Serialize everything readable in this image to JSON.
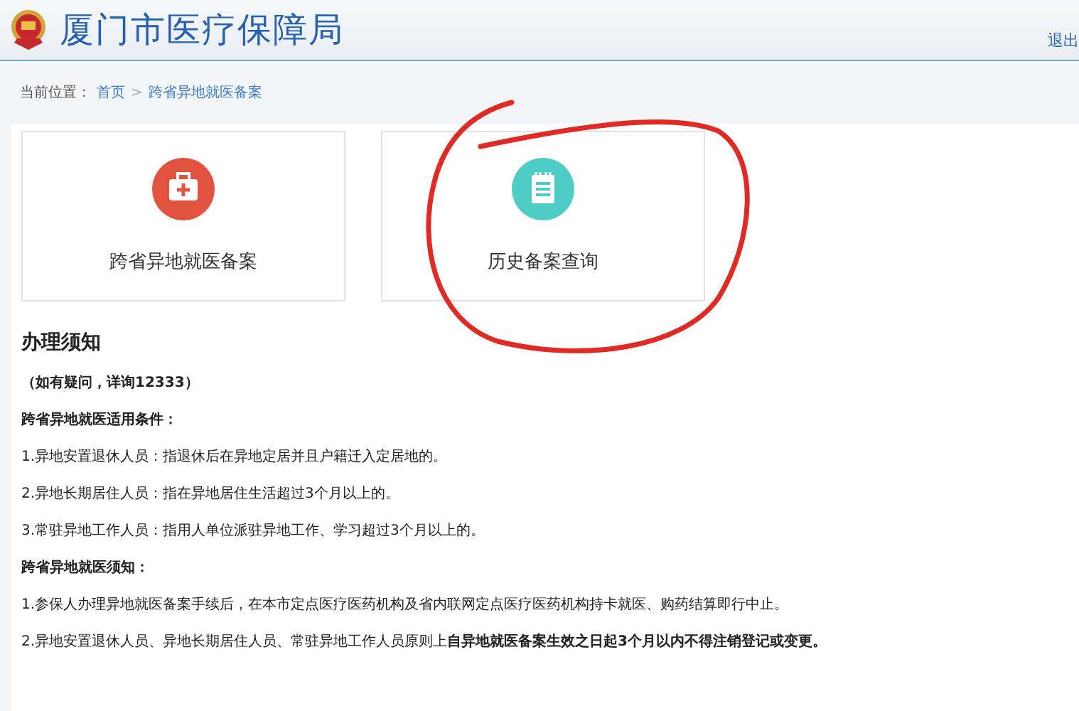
{
  "header": {
    "title": "厦门市医疗保障局",
    "logout": "退出"
  },
  "breadcrumb": {
    "label": "当前位置：",
    "items": [
      {
        "text": "首页",
        "kind": "link"
      },
      {
        "text": ">",
        "kind": "separator"
      },
      {
        "text": "跨省异地就医备案",
        "kind": "link"
      }
    ]
  },
  "cards": [
    {
      "label": "跨省异地就医备案",
      "kind": "medkit",
      "color": "#e0533f"
    },
    {
      "label": "历史备案查询",
      "kind": "notepad",
      "color": "#4ecdc4"
    }
  ],
  "notice": {
    "title": "办理须知",
    "lines": [
      {
        "text": "（如有疑问，详询12333）",
        "kind": "bold"
      },
      {
        "text": "跨省异地就医适用条件：",
        "kind": "bold"
      },
      {
        "text": "1.异地安置退休人员：指退休后在异地定居并且户籍迁入定居地的。",
        "kind": "plain"
      },
      {
        "text": "2.异地长期居住人员：指在异地居住生活超过3个月以上的。",
        "kind": "plain"
      },
      {
        "text": "3.常驻异地工作人员：指用人单位派驻异地工作、学习超过3个月以上的。",
        "kind": "plain"
      },
      {
        "text": "跨省异地就医须知：",
        "kind": "bold"
      },
      {
        "text": "1.参保人办理异地就医备案手续后，在本市定点医疗医药机构及省内联网定点医疗医药机构持卡就医、购药结算即行中止。",
        "kind": "plain"
      },
      {
        "text": "2.异地安置退休人员、异地长期居住人员、常驻异地工作人员原则上**自异地就医备案生效之日起3个月以内不得注销登记或变更。**",
        "kind": "plain"
      }
    ]
  },
  "annotation": {
    "kind": "circle"
  }
}
